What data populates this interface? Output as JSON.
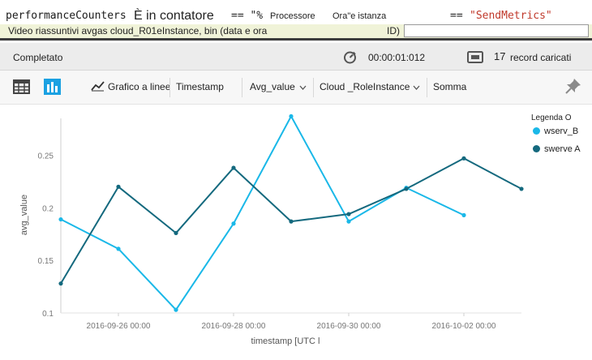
{
  "query": {
    "line1": {
      "table": "performanceCounters",
      "phrase": "È in contatore",
      "op1": "== \"%",
      "word1": "Processore",
      "word2": "Ora\"e istanza",
      "op2": "==",
      "value": "\"SendMetrics\""
    },
    "line2": {
      "text": "Video riassuntivi avgas cloud_R01eInstance, bin (data e ora",
      "tail": "ID)"
    }
  },
  "status": {
    "state": "Completato",
    "duration": "00:00:01:012",
    "records_count": "17",
    "records_label": "record caricati"
  },
  "toolbar": {
    "table_view_icon": "table-grid-icon",
    "chart_view_icon": "bar-chart-icon",
    "chart_type_label": "Grafico a linee",
    "x_field_label": "Timestamp",
    "y_field_label": "Avg_value",
    "split_field_label": "Cloud _RoleInstance",
    "aggregation_label": "Somma",
    "pin_icon": "pin-icon"
  },
  "chart_data": {
    "type": "line",
    "xlabel": "timestamp [UTC l",
    "ylabel": "avg_value",
    "x": [
      "2016-09-25",
      "2016-09-26",
      "2016-09-27",
      "2016-09-28",
      "2016-09-29",
      "2016-09-30",
      "2016-10-01",
      "2016-10-02",
      "2016-10-03"
    ],
    "xticks": [
      "2016-09-26 00:00",
      "2016-09-28 00:00",
      "2016-09-30 00:00",
      "2016-10-02 00:00"
    ],
    "yticks": [
      "0.1",
      "0.15",
      "0.2",
      "0.25"
    ],
    "ylim": [
      0.1,
      0.285
    ],
    "grid": "y-axis baseline only",
    "legend_title": "Legenda O",
    "legend_position": "top-right",
    "series": [
      {
        "name": "wserv_B",
        "color": "#1ab8e8",
        "values": [
          0.189,
          0.161,
          0.103,
          0.185,
          0.287,
          0.187,
          0.219,
          0.193,
          null
        ]
      },
      {
        "name": "swerve A",
        "color": "#14697e",
        "values": [
          0.128,
          0.22,
          0.176,
          0.238,
          0.187,
          0.194,
          0.218,
          0.247,
          0.218
        ]
      }
    ]
  }
}
